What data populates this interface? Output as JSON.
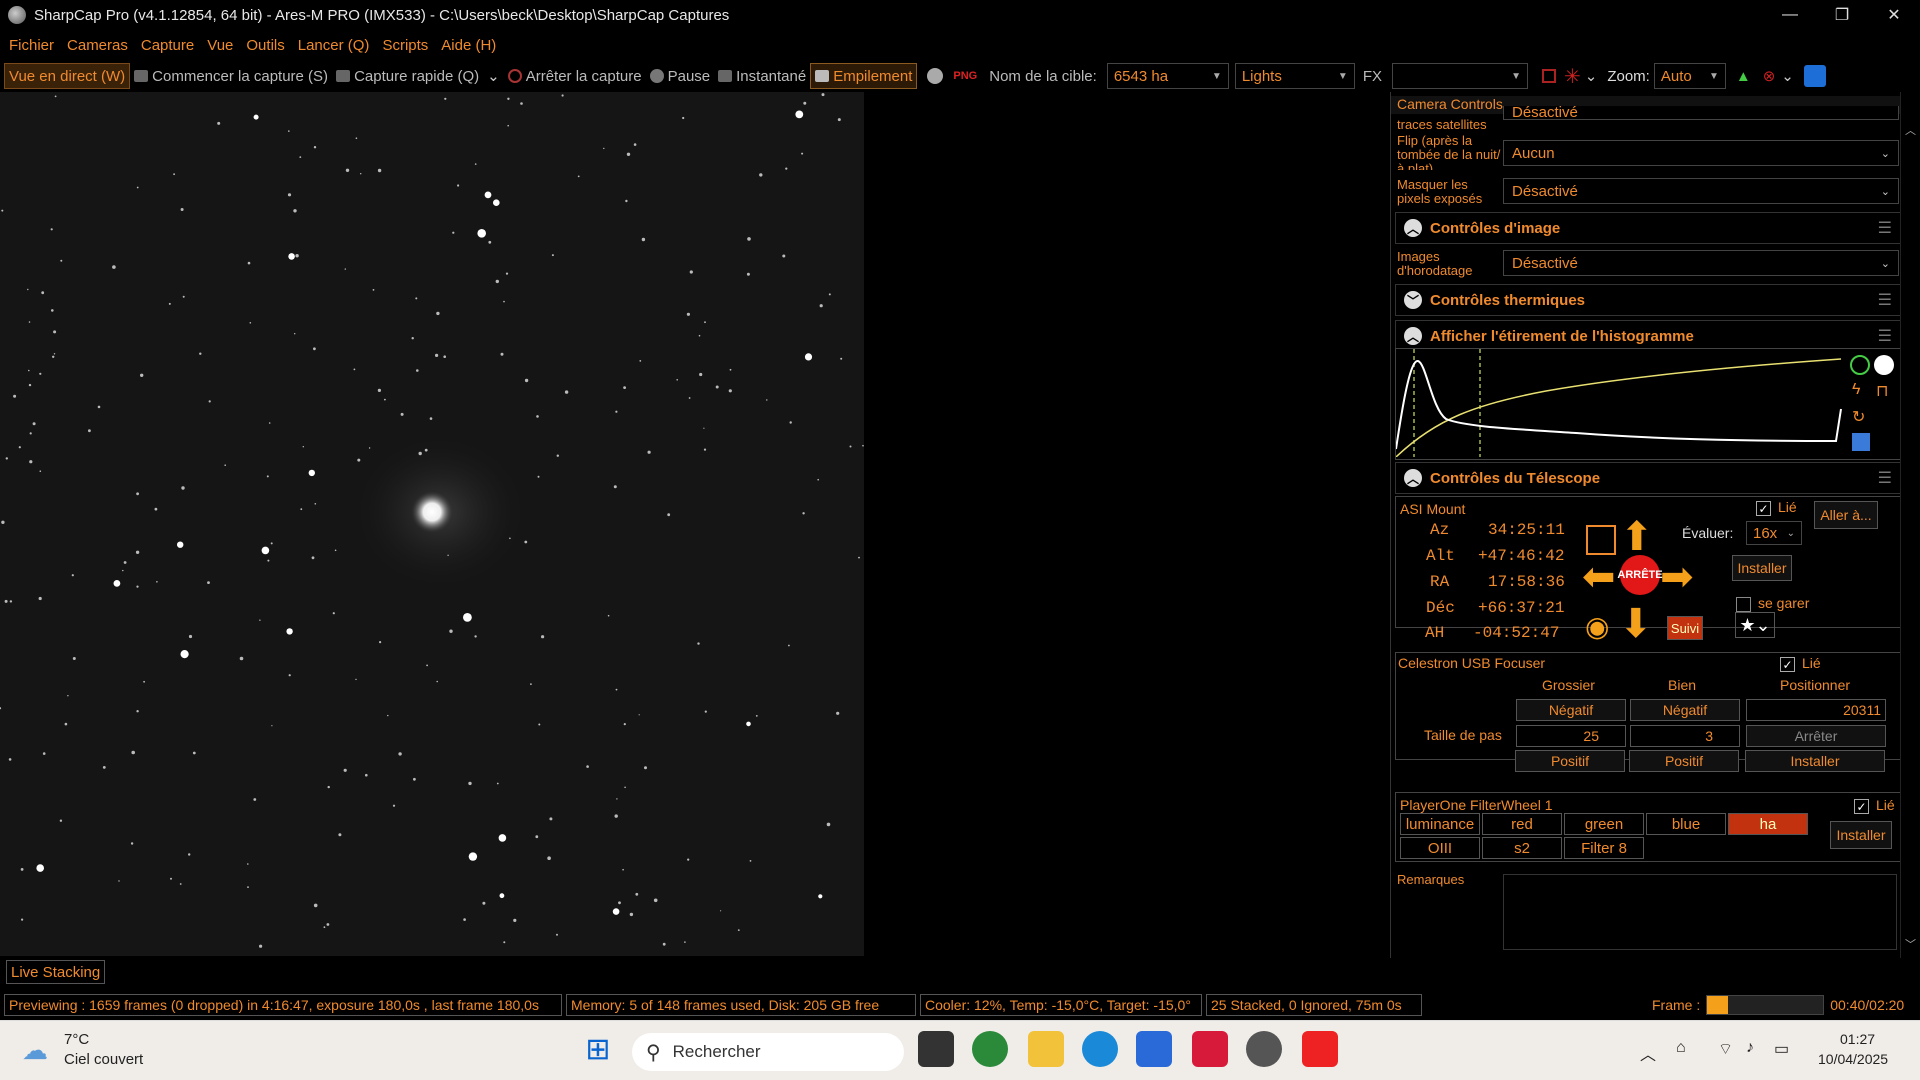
{
  "window": {
    "title": "SharpCap Pro (v4.1.12854, 64 bit) - Ares-M PRO (IMX533) - C:\\Users\\beck\\Desktop\\SharpCap Captures",
    "minimize": "—",
    "maximize": "❐",
    "close": "✕"
  },
  "menu": [
    "Fichier",
    "Cameras",
    "Capture",
    "Vue",
    "Outils",
    "Lancer (Q)",
    "Scripts",
    "Aide (H)"
  ],
  "toolbar": {
    "live_view": "Vue en direct (W)",
    "start_capture": "Commencer la capture (S)",
    "quick_capture": "Capture rapide (Q)",
    "stop_capture": "Arrêter la capture",
    "pause": "Pause",
    "snapshot": "Instantané",
    "stacking": "Empilement",
    "target_label": "Nom de la cible:",
    "target_value": "6543 ha",
    "frame_type": "Lights",
    "fx_label": "FX",
    "fx_value": "",
    "zoom_label": "Zoom:",
    "zoom_value": "Auto"
  },
  "panel": {
    "header": "Camera Controls",
    "row_traces_label": "traces satellites",
    "row_traces_value": "Désactivé",
    "row_flip_label": "Flip (après la tombée de la nuit/à plat)",
    "row_flip_value": "Aucun",
    "row_mask_label": "Masquer les pixels exposés",
    "row_mask_value": "Désactivé",
    "sec_image": "Contrôles d'image",
    "row_timestamp_label": "Images d'horodatage",
    "row_timestamp_value": "Désactivé",
    "sec_thermal": "Contrôles thermiques",
    "sec_histogram": "Afficher l'étirement de l'histogramme",
    "sec_telescope": "Contrôles du Télescope"
  },
  "mount": {
    "name": "ASI Mount",
    "linked": "Lié",
    "goto": "Aller à...",
    "az_label": "Az",
    "az": "34:25:11",
    "alt_label": "Alt",
    "alt": "+47:46:42",
    "ra_label": "RA",
    "ra": "17:58:36",
    "dec_label": "Déc",
    "dec": "+66:37:21",
    "ha_label": "AH",
    "ha": "-04:52:47",
    "rate_label": "Évaluer:",
    "rate": "16x",
    "install": "Installer",
    "park": "se garer",
    "stop": "ARRÊTE",
    "tracking": "Suivi"
  },
  "focuser": {
    "name": "Celestron USB Focuser",
    "linked": "Lié",
    "col_coarse": "Grossier",
    "col_fine": "Bien",
    "col_position": "Positionner",
    "negative": "Négatif",
    "positive": "Positif",
    "step_label": "Taille de pas",
    "coarse_step": "25",
    "fine_step": "3",
    "position": "20311",
    "stop": "Arrêter",
    "install": "Installer"
  },
  "filterwheel": {
    "name": "PlayerOne FilterWheel 1",
    "linked": "Lié",
    "filters_row1": [
      "luminance",
      "red",
      "green",
      "blue",
      "ha"
    ],
    "filters_row2": [
      "OIII",
      "s2",
      "Filter 8"
    ],
    "install": "Installer"
  },
  "notes_label": "Remarques",
  "live_stacking_tab": "Live Stacking",
  "status": {
    "preview": "Previewing : 1659 frames (0 dropped) in 4:16:47, exposure 180,0s , last frame 180,0s",
    "memory": "Memory: 5 of 148 frames used, Disk: 205 GB free",
    "cooler": "Cooler: 12%, Temp: -15,0°C, Target: -15,0°",
    "stacked": "25 Stacked, 0 Ignored, 75m 0s",
    "frame_label": "Frame :",
    "frame_time": "00:40/02:20",
    "frame_progress": 0.18
  },
  "taskbar": {
    "temp": "7°C",
    "weather": "Ciel couvert",
    "search": "Rechercher",
    "time": "01:27",
    "date": "10/04/2025"
  },
  "colors": {
    "accent": "#f08a2e",
    "selected_filter": "#c3320f"
  }
}
